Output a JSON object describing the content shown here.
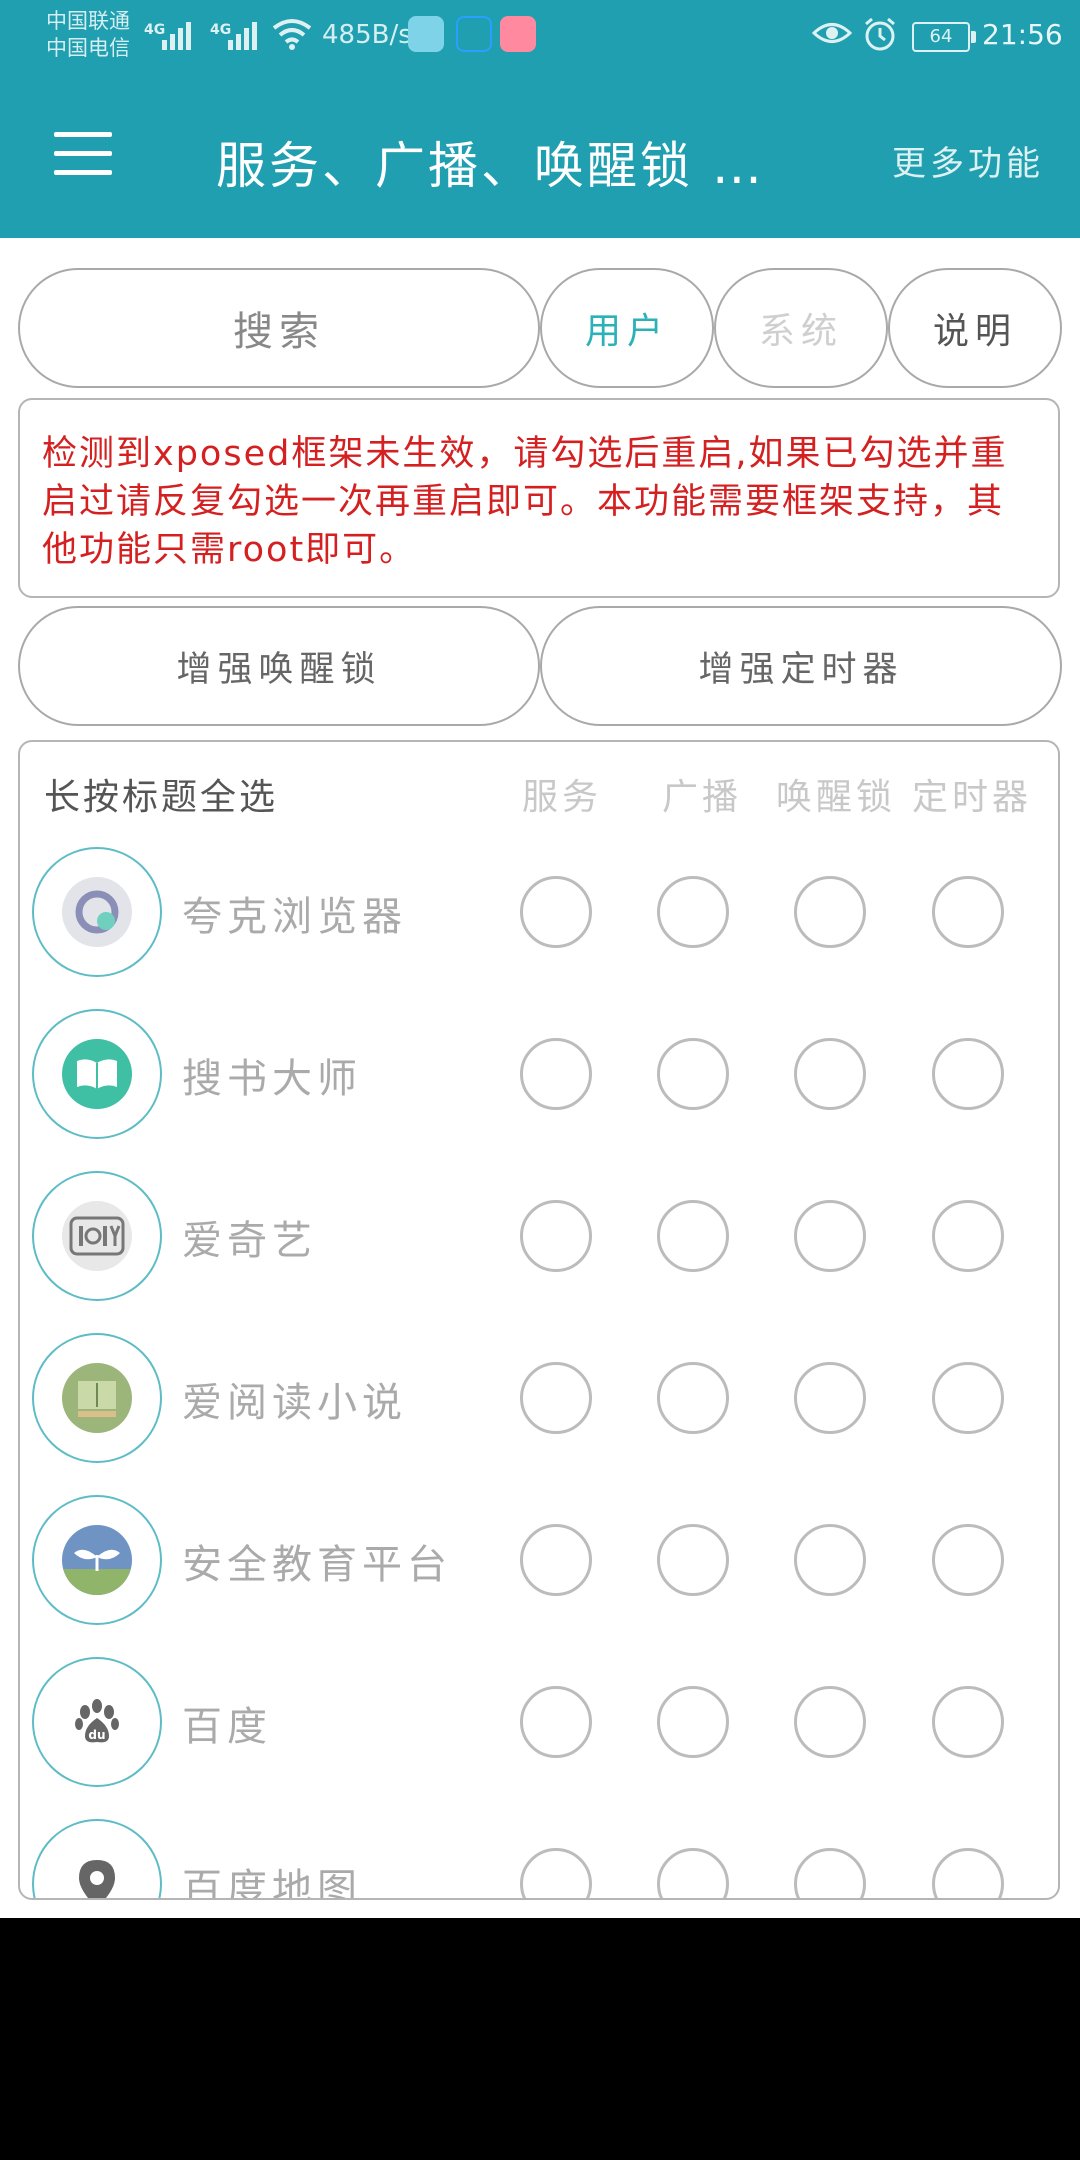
{
  "status_bar": {
    "carrier_1": "中国联通",
    "carrier_2": "中国电信",
    "network_1": "4G",
    "network_2": "4G",
    "speed": "485B/s",
    "battery": "64",
    "time": "21:56"
  },
  "header": {
    "title": "服务、广播、唤醒锁 …",
    "more": "更多功能"
  },
  "search": {
    "label": "搜索"
  },
  "filters": {
    "user": "用户",
    "system": "系统",
    "help": "说明"
  },
  "warning": "检测到xposed框架未生效，请勾选后重启,如果已勾选并重启过请反复勾选一次再重启即可。本功能需要框架支持，其他功能只需root即可。",
  "actions": {
    "enhance_wakelock": "增强唤醒锁",
    "enhance_timer": "增强定时器"
  },
  "list": {
    "select_all": "长按标题全选",
    "columns": [
      "服务",
      "广播",
      "唤醒锁",
      "定时器"
    ],
    "apps": [
      {
        "name": "夸克浏览器",
        "icon": "quark-browser-icon",
        "color": "#8b8fb8"
      },
      {
        "name": "搜书大师",
        "icon": "book-icon",
        "color": "#3fbfa3"
      },
      {
        "name": "爱奇艺",
        "icon": "iqiyi-icon",
        "color": "#e5e5e5"
      },
      {
        "name": "爱阅读小说",
        "icon": "reading-icon",
        "color": "#9bb57a"
      },
      {
        "name": "安全教育平台",
        "icon": "sprout-icon",
        "color": "#6f93c2"
      },
      {
        "name": "百度",
        "icon": "baidu-paw-icon",
        "color": "#ffffff"
      },
      {
        "name": "百度地图",
        "icon": "map-pin-icon",
        "color": "#ffffff"
      }
    ]
  },
  "colors": {
    "primary": "#1f9fb0",
    "accent": "#2bb1b8",
    "warning": "#d42020"
  }
}
